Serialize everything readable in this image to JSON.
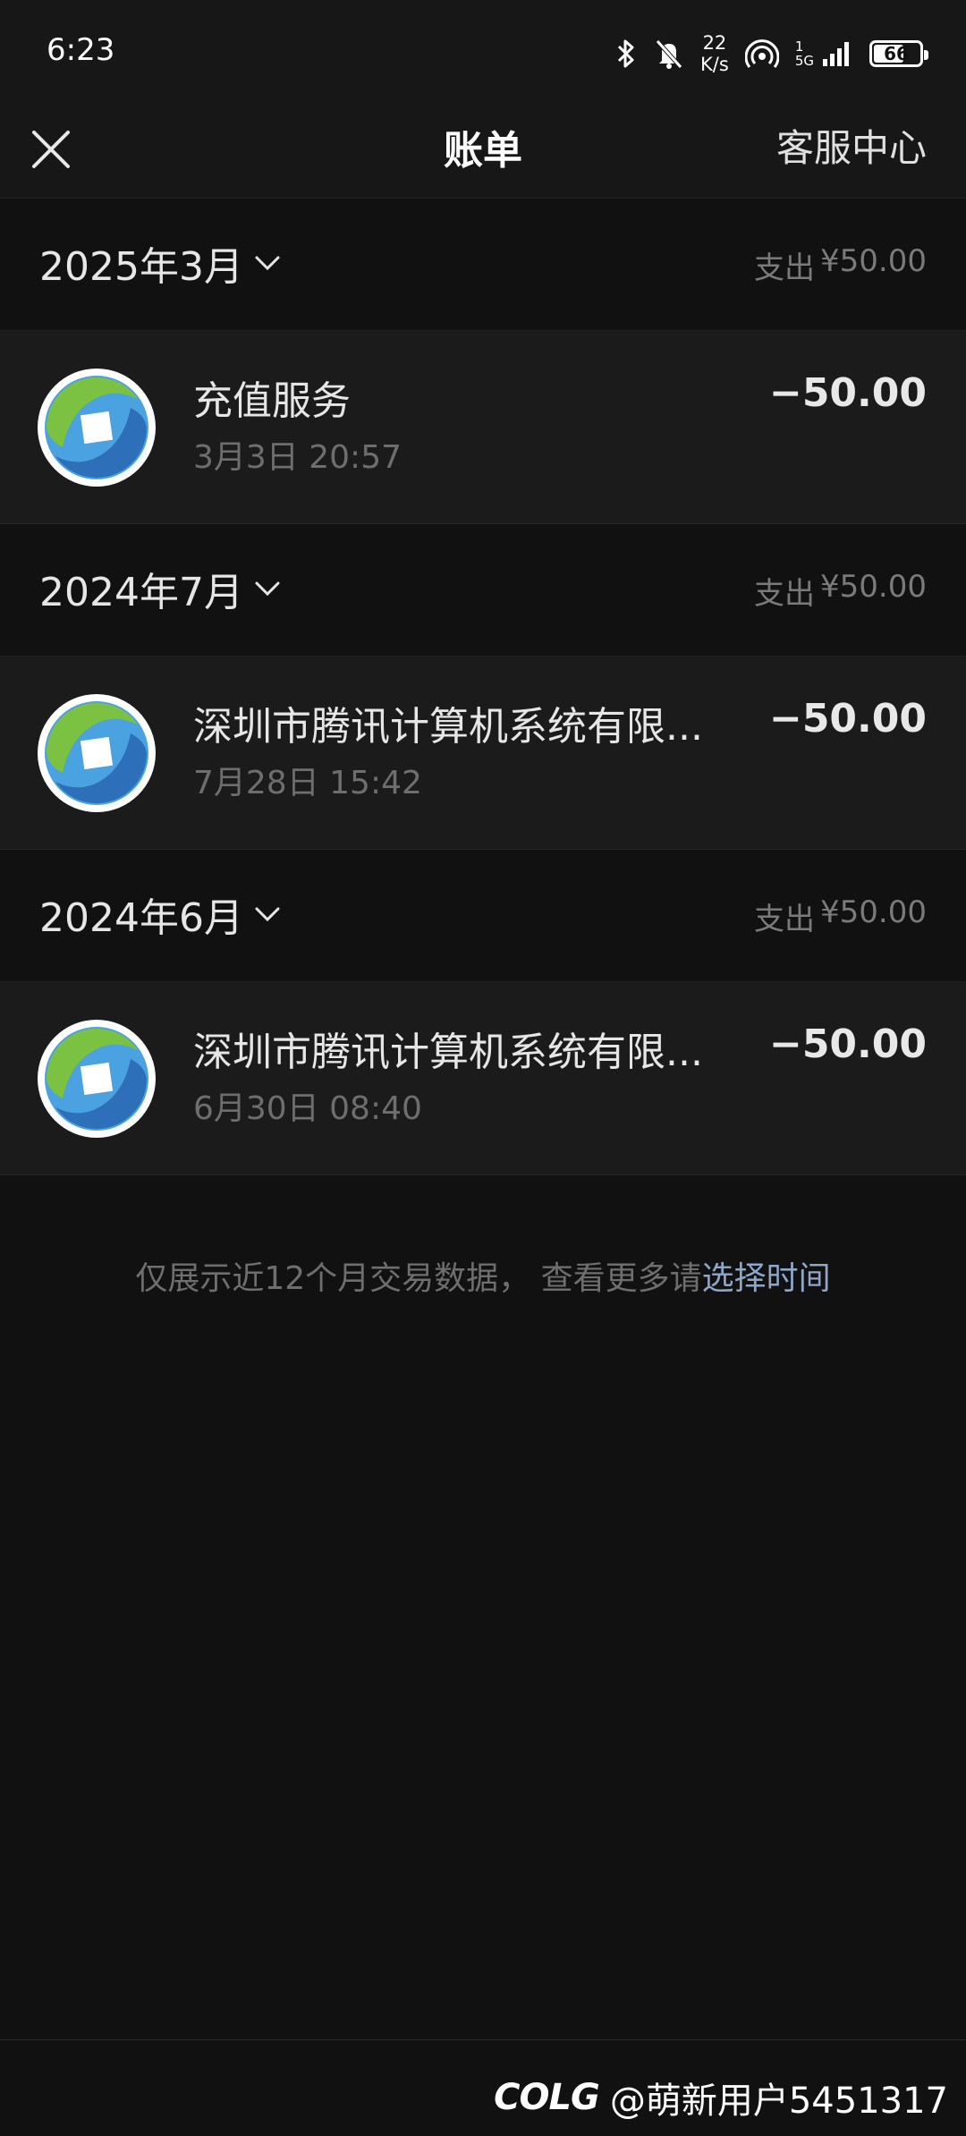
{
  "status_bar": {
    "time": "6:23",
    "net_speed_value": "22",
    "net_speed_unit": "K/s",
    "signal_tag_1": "1",
    "signal_tag_2": "5G",
    "battery": "66",
    "battery_level": 0.66,
    "icons": [
      "bluetooth-icon",
      "mute-bell-icon",
      "hotspot-icon",
      "cell-signal-icon",
      "battery-icon"
    ]
  },
  "header": {
    "title": "账单",
    "service": "客服中心",
    "close_icon": "close-icon"
  },
  "sections": [
    {
      "month": "2025年3月",
      "summary_label": "支出",
      "summary_amount": "¥50.00",
      "item": {
        "name": "充值服务",
        "time": "3月3日 20:57",
        "amount": "−50.00"
      }
    },
    {
      "month": "2024年7月",
      "summary_label": "支出",
      "summary_amount": "¥50.00",
      "item": {
        "name": "深圳市腾讯计算机系统有限...",
        "time": "7月28日 15:42",
        "amount": "−50.00"
      }
    },
    {
      "month": "2024年6月",
      "summary_label": "支出",
      "summary_amount": "¥50.00",
      "item": {
        "name": "深圳市腾讯计算机系统有限...",
        "time": "6月30日 08:40",
        "amount": "−50.00"
      }
    }
  ],
  "footer": {
    "note": "仅展示近12个月交易数据， 查看更多请",
    "link": "选择时间"
  },
  "watermark": {
    "logo": "COLG",
    "user": "@萌新用户5451317"
  },
  "colors": {
    "background": "#111111",
    "card": "#1b1b1b",
    "link": "#8ea6c8",
    "text_secondary": "#6e6e6e"
  }
}
